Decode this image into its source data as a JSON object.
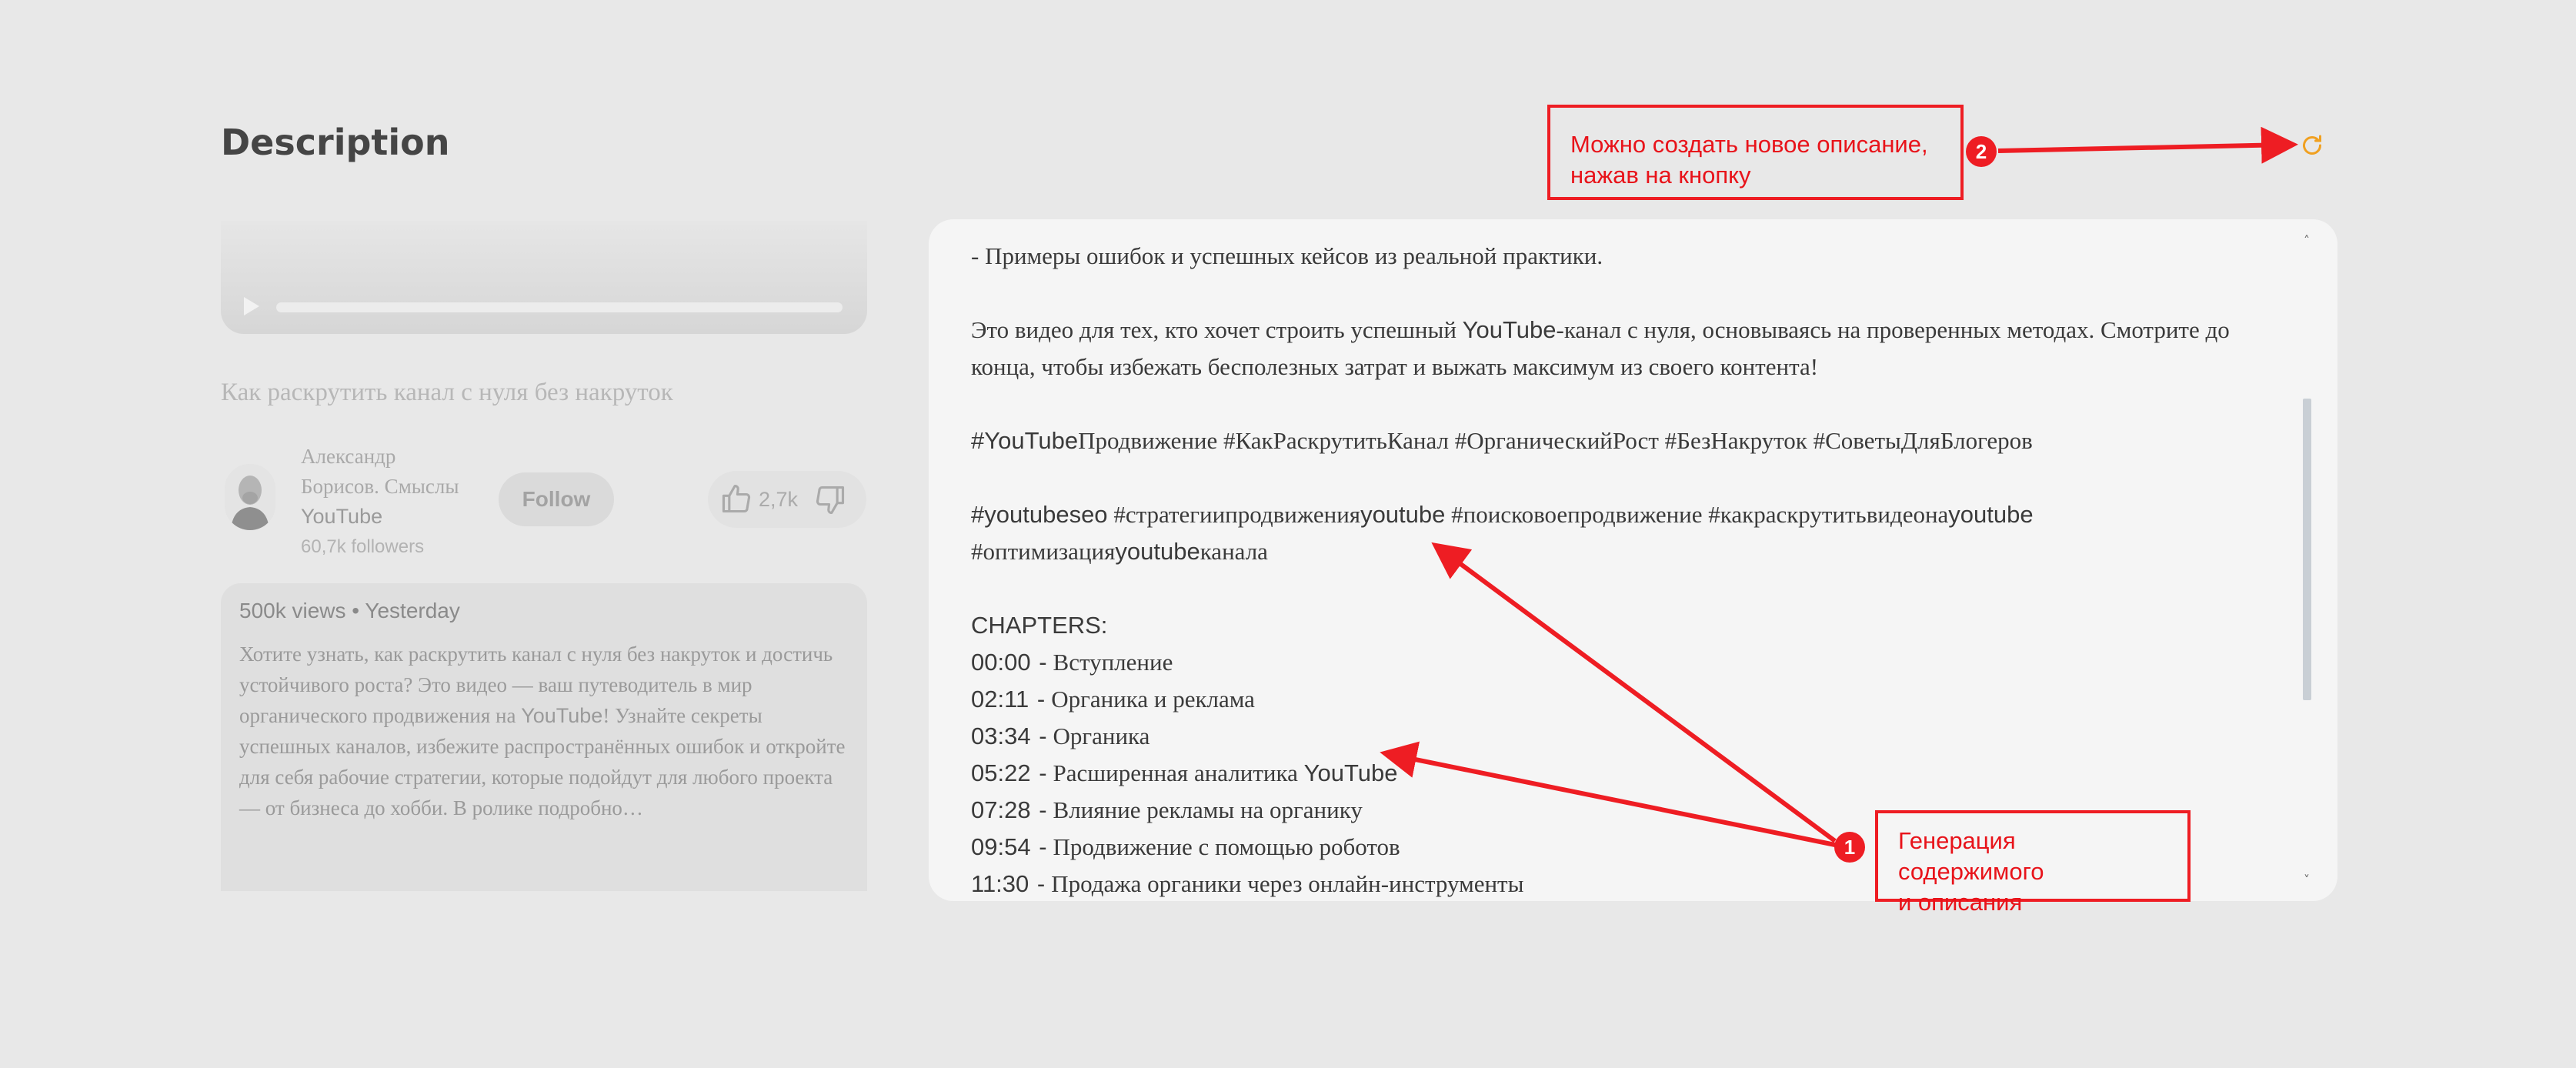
{
  "page": {
    "title": "Description"
  },
  "video": {
    "title": "Как раскрутить канал с нуля без накруток"
  },
  "channel": {
    "name_part1": "Александр",
    "name_part2": "Борисов. Смыслы",
    "name_part3": "YouTube",
    "followers": "60,7k followers",
    "follow_label": "Follow",
    "likes": "2,7k"
  },
  "description_card": {
    "meta": "500k views • Yesterday",
    "runs": [
      "Хотите узнать, как раскрутить канал с нуля без накруток и достичь устойчивого роста? Это видео — ваш путеводитель в мир органического продвижения на ",
      "YouTube",
      "! Узнайте секреты успешных каналов, избежите распространённых ошибок и откройте для себя рабочие стратегии, которые подойдут для любого проекта — от бизнеса до хобби. В ролике подробно…"
    ]
  },
  "generated": {
    "line1": "- Примеры ошибок и успешных кейсов из реальной практики.",
    "para2": [
      "Это видео для тех, кто хочет строить успешный ",
      "YouTube",
      "-канал с нуля, основываясь на проверенных методах. Смотрите до конца, чтобы избежать бесполезных затрат и выжать максимум из своего контента!"
    ],
    "hashtags1": [
      "#",
      "YouTube",
      "Продвижение #КакРаскрутитьКанал #ОрганическийРост #БезНакруток #СоветыДляБлогеров"
    ],
    "hashtags2": [
      "#",
      "youtubeseo",
      " #стратегиипродвижения",
      "youtube",
      " #поисковоепродвижение #какраскрутитьвидеона",
      "youtube",
      " #оптимизация",
      "youtube",
      "канала"
    ],
    "chapters_heading": "CHAPTERS:",
    "chapters": [
      {
        "time": "00:00",
        "title": "Вступление"
      },
      {
        "time": "02:11",
        "title": "Органика и реклама"
      },
      {
        "time": "03:34",
        "title": "Органика"
      },
      {
        "time": "05:22",
        "title": "Расширенная аналитика ",
        "brand": "YouTube"
      },
      {
        "time": "07:28",
        "title": "Влияние рекламы на органику"
      },
      {
        "time": "09:54",
        "title": "Продвижение с помощью роботов"
      },
      {
        "time": "11:30",
        "title": "Продажа органики через онлайн-инструменты"
      }
    ]
  },
  "annotations": {
    "box2_line1": "Можно создать новое описание,",
    "box2_line2": "нажав на кнопку",
    "badge2": "2",
    "box1_line1": "Генерация содержимого",
    "box1_line2": "и описания",
    "badge1": "1"
  },
  "colors": {
    "annotation_red": "#ee1d23",
    "regenerate_icon": "#f0a020",
    "background": "#e8e8e8",
    "panel": "#f5f5f5"
  },
  "icons": [
    "play-icon",
    "thumbs-up-icon",
    "thumbs-down-icon",
    "refresh-icon"
  ]
}
